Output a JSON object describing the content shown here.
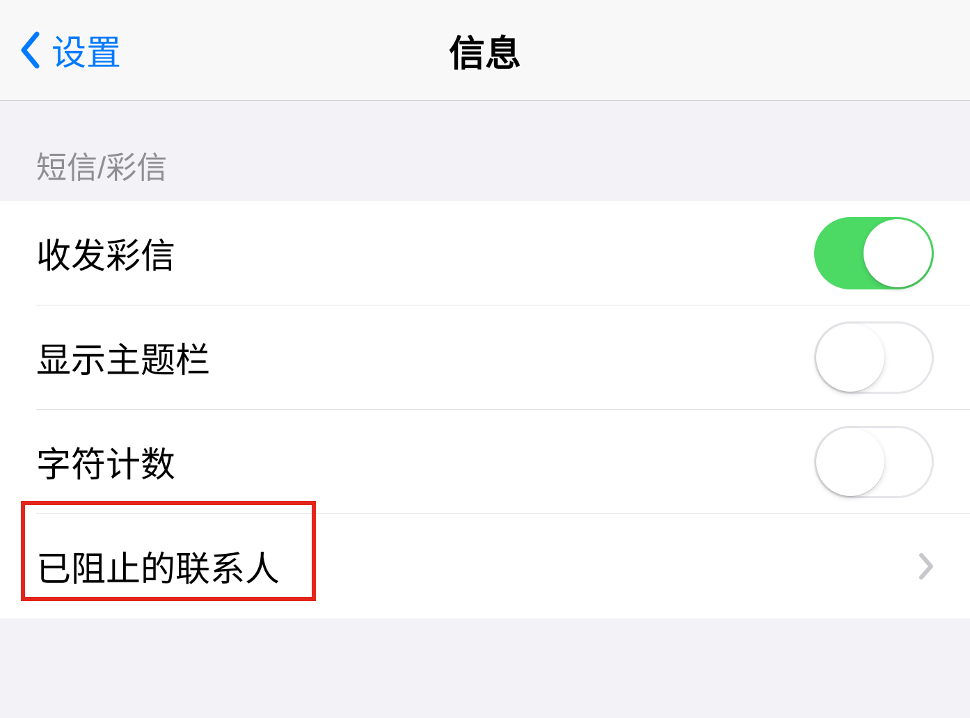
{
  "nav": {
    "back_label": "设置",
    "title": "信息"
  },
  "section": {
    "header": "短信/彩信"
  },
  "rows": {
    "mms": {
      "label": "收发彩信",
      "on": true
    },
    "subject": {
      "label": "显示主题栏",
      "on": false
    },
    "charcount": {
      "label": "字符计数",
      "on": false
    },
    "blocked": {
      "label": "已阻止的联系人"
    }
  }
}
